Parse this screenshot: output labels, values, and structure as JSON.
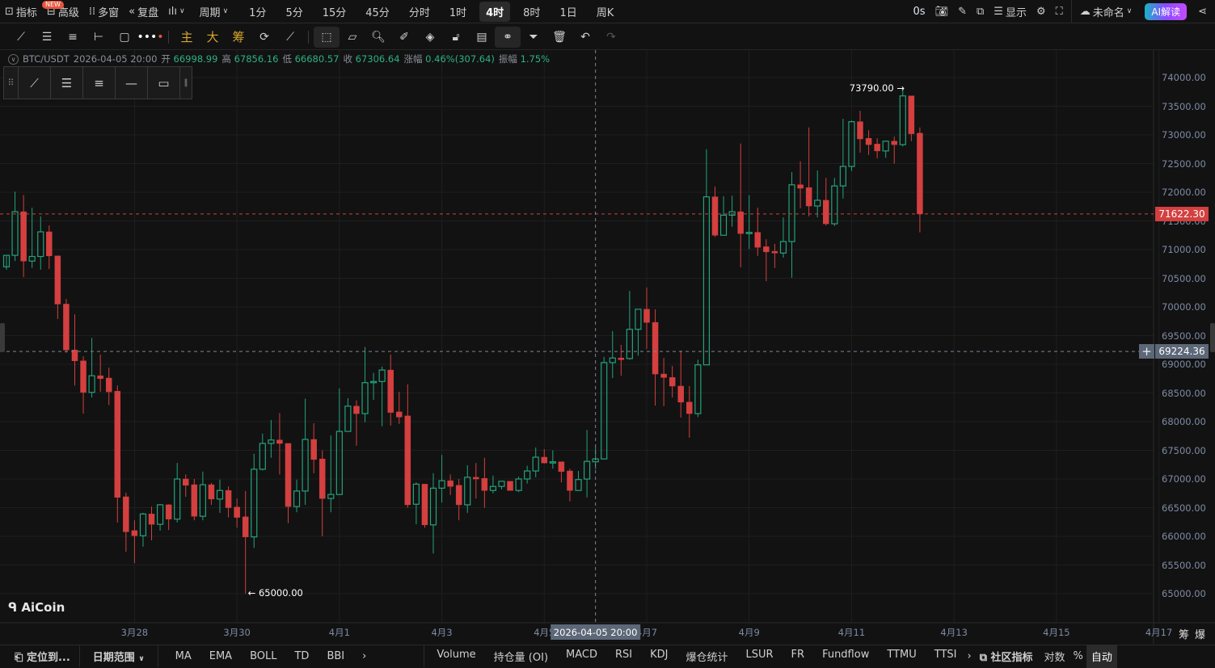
{
  "topbar": {
    "indicators": "指标",
    "new_badge": "NEW",
    "advanced": "高级",
    "multi_window": "多窗",
    "replay": "复盘",
    "period": "周期",
    "intervals": [
      "1分",
      "5分",
      "15分",
      "45分",
      "分时",
      "1时",
      "4时",
      "8时",
      "1日",
      "周K"
    ],
    "active_interval": "4时",
    "countdown": "0s",
    "display": "显示",
    "layout_name": "未命名",
    "ai_button": "AI解读"
  },
  "drawbar": {
    "main": "主",
    "big": "大",
    "chips": "筹"
  },
  "info": {
    "symbol": "BTC/USDT",
    "time": "2026-04-05 20:00",
    "open_label": "开",
    "open": "66998.99",
    "high_label": "高",
    "high": "67856.16",
    "low_label": "低",
    "low": "66680.57",
    "close_label": "收",
    "close": "67306.64",
    "change_label": "涨幅",
    "change": "0.46%(307.64)",
    "amp_label": "振幅",
    "amp": "1.75%"
  },
  "logo": "AiCoin",
  "price_axis": {
    "labels": [
      "74000.00",
      "73500.00",
      "73000.00",
      "72500.00",
      "72000.00",
      "71500.00",
      "71000.00",
      "70500.00",
      "70000.00",
      "69500.00",
      "69000.00",
      "68500.00",
      "68000.00",
      "67500.00",
      "67000.00",
      "66500.00",
      "66000.00",
      "65500.00",
      "65000.00"
    ],
    "last_price": "71622.30",
    "crosshair_price": "69224.36",
    "last_color": "#d43f3f"
  },
  "annotations": {
    "max": "73790.00",
    "min": "65000.00"
  },
  "time_axis": {
    "labels": [
      "3月28",
      "3月30",
      "4月1",
      "4月3",
      "4月5",
      "4月7",
      "4月9",
      "4月11",
      "4月13",
      "4月15",
      "4月17"
    ],
    "crosshair_time": "2026-04-05 20:00",
    "chips": "筹",
    "liq": "爆"
  },
  "bottombar": {
    "locate": "定位到...",
    "date_range": "日期范围",
    "main_ind": [
      "MA",
      "EMA",
      "BOLL",
      "TD",
      "BBI"
    ],
    "sub_ind": [
      "Volume",
      "持仓量 (OI)",
      "MACD",
      "RSI",
      "KDJ",
      "爆仓统计",
      "LSUR",
      "FR",
      "Fundflow",
      "TTMU",
      "TTSI"
    ],
    "community": "社区指标",
    "log": "对数",
    "percent": "%",
    "auto": "自动"
  },
  "colors": {
    "up": "#22a37c",
    "down": "#d43f3f",
    "bg": "#121212"
  },
  "chart_data": {
    "type": "candlestick",
    "interval": "4h",
    "ylim": [
      65000,
      74000
    ],
    "first_label_index": 15,
    "label_step": 12,
    "crosshair_index": 69,
    "candles": [
      [
        70700,
        70700,
        70650,
        70900
      ],
      [
        70900,
        72010,
        70800,
        71660
      ],
      [
        71660,
        71950,
        70520,
        70800
      ],
      [
        70800,
        71730,
        70680,
        70880
      ],
      [
        70880,
        71580,
        70650,
        71310
      ],
      [
        71310,
        71420,
        70660,
        70890
      ],
      [
        70890,
        70890,
        69790,
        70050
      ],
      [
        70050,
        70140,
        69200,
        69250
      ],
      [
        69250,
        69870,
        68630,
        69060
      ],
      [
        69060,
        69140,
        68140,
        68510
      ],
      [
        68510,
        69460,
        68420,
        68800
      ],
      [
        68800,
        69170,
        68520,
        68750
      ],
      [
        68760,
        68940,
        68290,
        68520
      ],
      [
        68530,
        68630,
        66240,
        66680
      ],
      [
        66690,
        66760,
        65730,
        66080
      ],
      [
        66100,
        66280,
        65530,
        66010
      ],
      [
        66010,
        66410,
        65820,
        66390
      ],
      [
        66390,
        66520,
        65930,
        66210
      ],
      [
        66210,
        66560,
        66100,
        66550
      ],
      [
        66550,
        66560,
        66110,
        66300
      ],
      [
        66300,
        67280,
        66240,
        67000
      ],
      [
        67000,
        67080,
        66690,
        66890
      ],
      [
        66900,
        67000,
        66280,
        66350
      ],
      [
        66350,
        67130,
        66280,
        66900
      ],
      [
        66900,
        66930,
        66550,
        66650
      ],
      [
        66650,
        66990,
        66410,
        66800
      ],
      [
        66800,
        66870,
        66330,
        66500
      ],
      [
        66510,
        66660,
        66150,
        66330
      ],
      [
        66340,
        66790,
        65000,
        65990
      ],
      [
        65990,
        67440,
        65800,
        67170
      ],
      [
        67170,
        67790,
        67150,
        67620
      ],
      [
        67620,
        68030,
        67370,
        67680
      ],
      [
        67680,
        68150,
        67080,
        67620
      ],
      [
        67620,
        67620,
        66230,
        66520
      ],
      [
        66520,
        66990,
        66420,
        66790
      ],
      [
        66790,
        68400,
        66550,
        67690
      ],
      [
        67690,
        67970,
        67100,
        67340
      ],
      [
        67350,
        67500,
        66000,
        66660
      ],
      [
        66660,
        67760,
        66420,
        66730
      ],
      [
        66730,
        68580,
        66730,
        67830
      ],
      [
        67830,
        68410,
        67830,
        68270
      ],
      [
        68270,
        68370,
        67580,
        68140
      ],
      [
        68140,
        69300,
        67990,
        68680
      ],
      [
        68680,
        68850,
        68380,
        68700
      ],
      [
        68700,
        68960,
        67920,
        68900
      ],
      [
        68900,
        69170,
        67930,
        68160
      ],
      [
        68170,
        68520,
        67960,
        68080
      ],
      [
        68100,
        68650,
        66500,
        66550
      ],
      [
        66560,
        66940,
        66210,
        66910
      ],
      [
        66910,
        66910,
        66150,
        66200
      ],
      [
        66200,
        67100,
        65700,
        66840
      ],
      [
        66840,
        67420,
        66590,
        66970
      ],
      [
        66970,
        67080,
        66720,
        66870
      ],
      [
        66890,
        67000,
        66280,
        66550
      ],
      [
        66550,
        67240,
        66410,
        67030
      ],
      [
        67030,
        67280,
        66660,
        67000
      ],
      [
        67010,
        67370,
        66500,
        66800
      ],
      [
        66800,
        67060,
        66750,
        66870
      ],
      [
        66870,
        66960,
        66820,
        66960
      ],
      [
        66960,
        66960,
        66800,
        66800
      ],
      [
        66800,
        67040,
        66770,
        67000
      ],
      [
        67000,
        67230,
        66920,
        67140
      ],
      [
        67140,
        67550,
        67030,
        67380
      ],
      [
        67380,
        67520,
        67270,
        67280
      ],
      [
        67280,
        67500,
        67180,
        67300
      ],
      [
        67300,
        67300,
        66940,
        67130
      ],
      [
        67140,
        67180,
        66610,
        66800
      ],
      [
        66800,
        67140,
        66800,
        66990
      ],
      [
        66998.99,
        67856.16,
        66680.57,
        67306.64
      ],
      [
        67300,
        67550,
        67170,
        67350
      ],
      [
        67350,
        69130,
        67350,
        69030
      ],
      [
        69030,
        69580,
        68760,
        69110
      ],
      [
        69110,
        69340,
        68800,
        69080
      ],
      [
        69100,
        70280,
        69080,
        69610
      ],
      [
        69610,
        69960,
        69150,
        69960
      ],
      [
        69960,
        70340,
        69270,
        69730
      ],
      [
        69730,
        69960,
        68280,
        68830
      ],
      [
        68830,
        69110,
        68270,
        68770
      ],
      [
        68770,
        68970,
        68420,
        68620
      ],
      [
        68620,
        69240,
        68070,
        68340
      ],
      [
        68340,
        68620,
        67720,
        68140
      ],
      [
        68140,
        69080,
        68080,
        68990
      ],
      [
        68990,
        72750,
        68990,
        71920
      ],
      [
        71920,
        72100,
        71220,
        71250
      ],
      [
        71250,
        71930,
        71250,
        71600
      ],
      [
        71600,
        71940,
        71400,
        71660
      ],
      [
        71660,
        72850,
        70690,
        71280
      ],
      [
        71280,
        71950,
        71010,
        71300
      ],
      [
        71300,
        71730,
        70890,
        71040
      ],
      [
        71050,
        71180,
        70450,
        70960
      ],
      [
        70970,
        71100,
        70680,
        70940
      ],
      [
        70940,
        71560,
        70860,
        71140
      ],
      [
        71140,
        72350,
        70510,
        72130
      ],
      [
        72130,
        72540,
        71720,
        72070
      ],
      [
        72080,
        73130,
        71580,
        71760
      ],
      [
        71760,
        72380,
        71560,
        71860
      ],
      [
        71860,
        72250,
        71420,
        71450
      ],
      [
        71450,
        72250,
        71410,
        72110
      ],
      [
        72110,
        73280,
        71890,
        72450
      ],
      [
        72450,
        73250,
        72370,
        73230
      ],
      [
        73230,
        73420,
        72690,
        72930
      ],
      [
        72940,
        73080,
        72650,
        72830
      ],
      [
        72840,
        72940,
        72590,
        72720
      ],
      [
        72720,
        72900,
        72600,
        72890
      ],
      [
        72890,
        72970,
        72500,
        72830
      ],
      [
        72830,
        73790,
        72800,
        73680
      ],
      [
        73680,
        73680,
        72890,
        73020
      ],
      [
        73030,
        73130,
        71300,
        71622.3
      ]
    ]
  }
}
